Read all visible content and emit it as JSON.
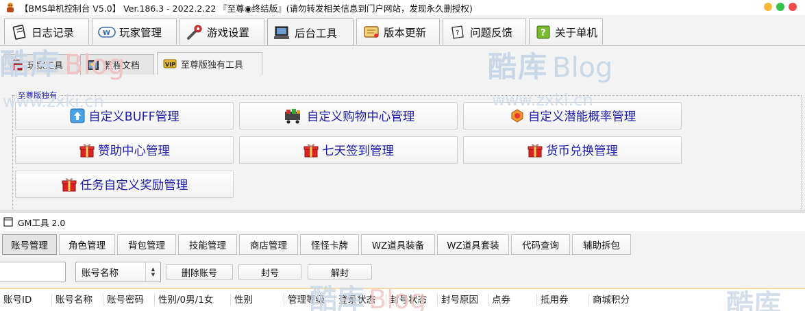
{
  "window": {
    "title": "【BMS单机控制台 V5.0】 Ver.186.3 - 2022.2.22 『至尊◉终结版』(请勿转发相关信息到门户网站，发现永久删授权)"
  },
  "main_tabs": [
    {
      "label": "日志记录",
      "icon": "notebook-icon"
    },
    {
      "label": "玩家管理",
      "icon": "web-card-icon"
    },
    {
      "label": "游戏设置",
      "icon": "wrench-icon"
    },
    {
      "label": "后台工具",
      "icon": "computer-icon"
    },
    {
      "label": "版本更新",
      "icon": "scroll-icon"
    },
    {
      "label": "问题反馈",
      "icon": "feedback-icon"
    },
    {
      "label": "关于单机",
      "icon": "help-icon"
    }
  ],
  "sub_tabs": [
    {
      "label": "玩家工具",
      "icon": "toolbox-icon"
    },
    {
      "label": "教程文档",
      "icon": "picture-icon"
    },
    {
      "label": "至尊版独有工具",
      "icon": "vip-icon"
    }
  ],
  "group": {
    "label": "至尊版独有",
    "buttons": [
      {
        "label": "自定义BUFF管理",
        "icon": "buff-icon"
      },
      {
        "label": "自定义购物中心管理",
        "icon": "shop-icon"
      },
      {
        "label": "自定义潜能概率管理",
        "icon": "potential-icon"
      },
      {
        "label": "赞助中心管理",
        "icon": "gift-icon"
      },
      {
        "label": "七天签到管理",
        "icon": "gift-icon"
      },
      {
        "label": "货币兑换管理",
        "icon": "gift-icon"
      },
      {
        "label": "任务自定义奖励管理",
        "icon": "gift-icon"
      }
    ]
  },
  "gm": {
    "title": "GM工具 2.0",
    "tabs": [
      "账号管理",
      "角色管理",
      "背包管理",
      "技能管理",
      "商店管理",
      "怪怪卡牌",
      "WZ道具装备",
      "WZ道具套装",
      "代码查询",
      "辅助拆包"
    ],
    "search_value": "",
    "select_value": "账号名称",
    "delete_label": "删除账号",
    "ban_label": "封号",
    "unban_label": "解封",
    "columns": [
      "账号ID",
      "账号名称",
      "账号密码",
      "性别/0男/1女",
      "性别",
      "管理等级",
      "登录状态",
      "封号状态",
      "封号原因",
      "点券",
      "抵用券",
      "商城积分"
    ]
  },
  "watermark": {
    "brand": "酷库",
    "blog": "Blog",
    "site": "www.zxki.cn"
  },
  "colors": {
    "accent_text": "#1e1ea8",
    "watermark": "#c9d7e6",
    "watermark_red": "#efc3c3"
  }
}
